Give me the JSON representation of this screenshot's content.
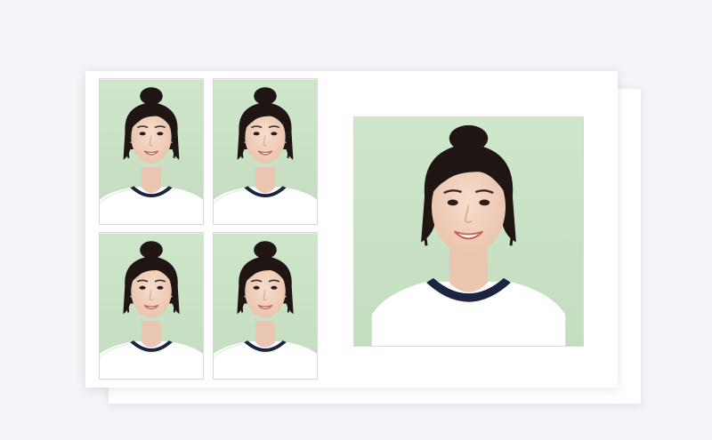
{
  "colors": {
    "page_background": "#f3f4f7",
    "sheet": "#ffffff",
    "photo_background": "#c9e2c5",
    "hair": "#1f1613",
    "skin": "#f2d3c0",
    "shirt": "#ffffff",
    "collar": "#1d2440"
  },
  "photos": [
    {
      "kind": "small-id-photo"
    },
    {
      "kind": "small-id-photo"
    },
    {
      "kind": "small-id-photo"
    },
    {
      "kind": "small-id-photo"
    },
    {
      "kind": "large-id-photo"
    }
  ]
}
